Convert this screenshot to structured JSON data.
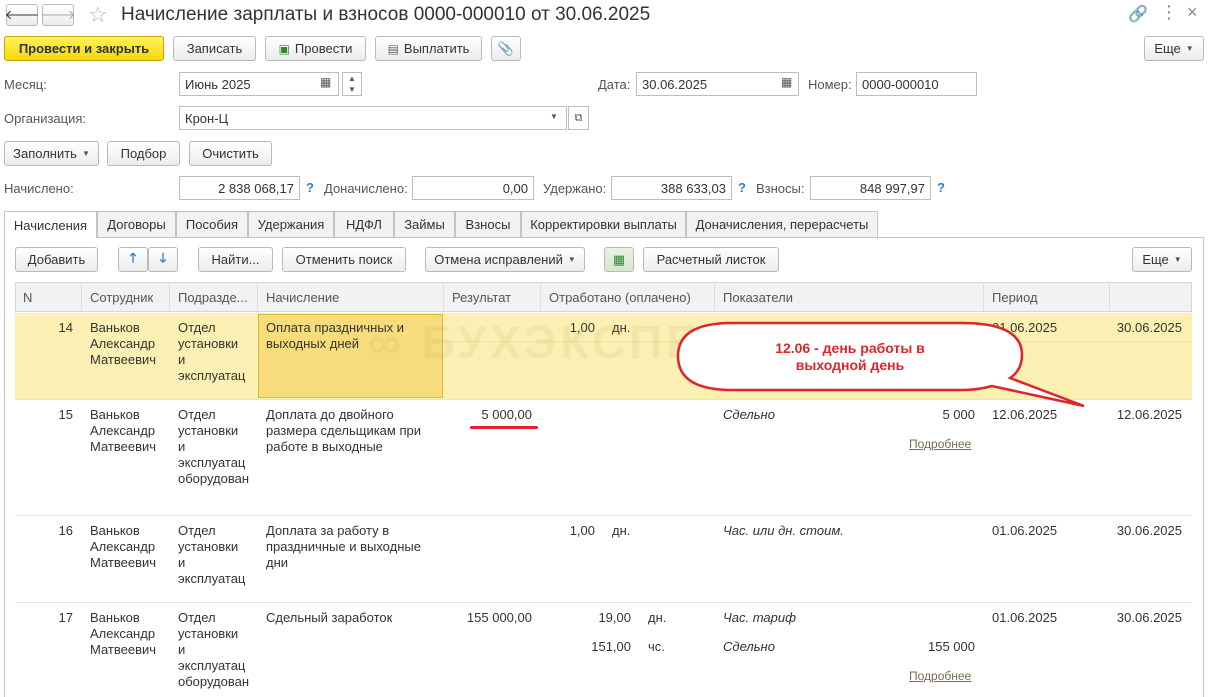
{
  "window": {
    "title": "Начисление зарплаты и взносов 0000-000010 от 30.06.2025"
  },
  "toolbar": {
    "post_close": "Провести и закрыть",
    "save": "Записать",
    "post": "Провести",
    "pay": "Выплатить",
    "more": "Еще"
  },
  "header": {
    "month_label": "Месяц:",
    "month_value": "Июнь 2025",
    "date_label": "Дата:",
    "date_value": "30.06.2025",
    "number_label": "Номер:",
    "number_value": "0000-000010",
    "org_label": "Организация:",
    "org_value": "Крон-Ц"
  },
  "actions": {
    "fill": "Заполнить",
    "select": "Подбор",
    "clear": "Очистить"
  },
  "totals": {
    "accrued_label": "Начислено:",
    "accrued_value": "2 838 068,17",
    "additional_label": "Доначислено:",
    "additional_value": "0,00",
    "withheld_label": "Удержано:",
    "withheld_value": "388 633,03",
    "contrib_label": "Взносы:",
    "contrib_value": "848 997,97",
    "help": "?"
  },
  "tabs": [
    "Начисления",
    "Договоры",
    "Пособия",
    "Удержания",
    "НДФЛ",
    "Займы",
    "Взносы",
    "Корректировки выплаты",
    "Доначисления, перерасчеты"
  ],
  "table_toolbar": {
    "add": "Добавить",
    "find": "Найти...",
    "cancel_search": "Отменить поиск",
    "cancel_fixes": "Отмена исправлений",
    "payslip": "Расчетный листок",
    "more": "Еще"
  },
  "columns": {
    "n": "N",
    "employee": "Сотрудник",
    "dept": "Подразде...",
    "accrual": "Начисление",
    "result": "Результат",
    "worked": "Отработано (оплачено)",
    "indicators": "Показатели",
    "period": "Период"
  },
  "rows": [
    {
      "n": "14",
      "employee": [
        "Ваньков",
        "Александр",
        "Матвеевич"
      ],
      "dept": [
        "Отдел",
        "установки",
        "и",
        "эксплуатац"
      ],
      "accrual": [
        "Оплата праздничных и",
        "выходных дней"
      ],
      "result": "",
      "worked": [
        "1,00"
      ],
      "unit": [
        "дн."
      ],
      "indicators": [],
      "period_from": "01.06.2025",
      "period_to": "30.06.2025"
    },
    {
      "n": "15",
      "employee": [
        "Ваньков",
        "Александр",
        "Матвеевич"
      ],
      "dept": [
        "Отдел",
        "установки",
        "и",
        "эксплуатац",
        "оборудован"
      ],
      "accrual": [
        "Доплата до двойного",
        "размера сдельщикам при",
        "работе в выходные"
      ],
      "result": "5 000,00",
      "worked": [],
      "unit": [],
      "indicators": [
        {
          "name": "Сдельно",
          "value": "5 000"
        }
      ],
      "details": "Подробнее",
      "period_from": "12.06.2025",
      "period_to": "12.06.2025"
    },
    {
      "n": "16",
      "employee": [
        "Ваньков",
        "Александр",
        "Матвеевич"
      ],
      "dept": [
        "Отдел",
        "установки",
        "и",
        "эксплуатац"
      ],
      "accrual": [
        "Доплата за работу в",
        "праздничные и выходные",
        "дни"
      ],
      "result": "",
      "worked": [
        "1,00"
      ],
      "unit": [
        "дн."
      ],
      "indicators": [
        {
          "name": "Час. или дн. стоим.",
          "value": ""
        }
      ],
      "period_from": "01.06.2025",
      "period_to": "30.06.2025"
    },
    {
      "n": "17",
      "employee": [
        "Ваньков",
        "Александр",
        "Матвеевич"
      ],
      "dept": [
        "Отдел",
        "установки",
        "и",
        "эксплуатац",
        "оборудован"
      ],
      "accrual": [
        "Сдельный заработок"
      ],
      "result": "155 000,00",
      "worked": [
        "19,00",
        "151,00"
      ],
      "unit": [
        "дн.",
        "чс."
      ],
      "indicators": [
        {
          "name": "Час. тариф",
          "value": ""
        },
        {
          "name": "Сдельно",
          "value": "155 000"
        }
      ],
      "details": "Подробнее",
      "period_from": "01.06.2025",
      "period_to": "30.06.2025"
    }
  ],
  "callout": {
    "text_line1": "12.06 - день работы в",
    "text_line2": "выходной день",
    "color": "#e0242b"
  },
  "watermark": "БУХЭКСПЕРТ",
  "colors": {
    "primary_button": "#f5d80b",
    "selected_row": "#fbf0b4",
    "selected_cell": "#f6dc7a",
    "help_icon": "#2a7fd0",
    "annotation": "#e0242b"
  }
}
